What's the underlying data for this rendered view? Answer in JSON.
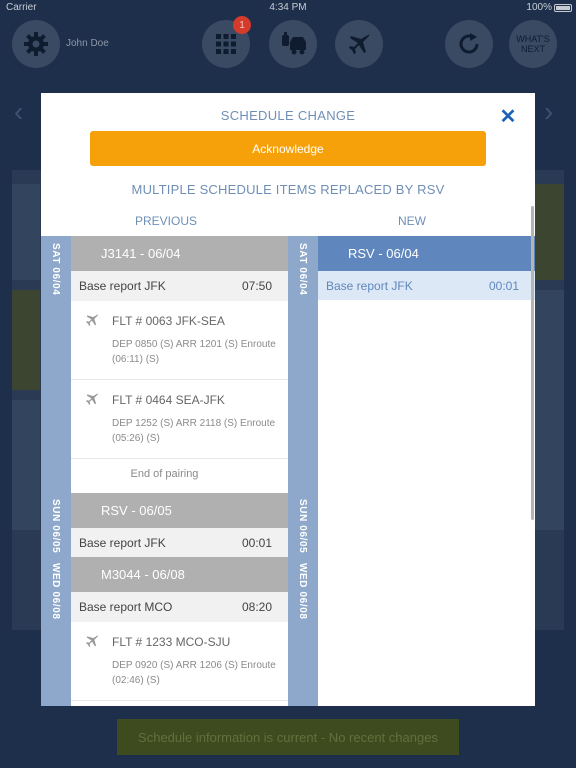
{
  "status_bar": {
    "carrier": "Carrier",
    "time": "4:34 PM",
    "battery": "100%"
  },
  "top_bar": {
    "user_name": "John Doe",
    "notification_count": "1",
    "whats_next_label": "WHAT'S NEXT"
  },
  "background": {
    "status_message": "Schedule information is current - No recent changes"
  },
  "modal": {
    "title": "SCHEDULE CHANGE",
    "acknowledge_label": "Acknowledge",
    "subtitle": "MULTIPLE SCHEDULE ITEMS REPLACED BY RSV",
    "previous_label": "PREVIOUS",
    "new_label": "NEW",
    "previous": {
      "day1": "SAT 06/04",
      "day2": "SUN 06/05",
      "day3": "WED 06/08",
      "pairing1": "J3141 - 06/04",
      "base1": {
        "label": "Base report  JFK",
        "time": "07:50"
      },
      "flt1": {
        "title": "FLT # 0063 JFK-SEA",
        "detail": "DEP 0850 (S)  ARR 1201 (S) Enroute (06:11) (S)"
      },
      "flt2": {
        "title": "FLT # 0464 SEA-JFK",
        "detail": "DEP 1252 (S)  ARR 2118 (S) Enroute (05:26) (S)"
      },
      "end_of_pairing": "End of pairing",
      "rsv": "RSV - 06/05",
      "base2": {
        "label": "Base report  JFK",
        "time": "00:01"
      },
      "pairing2": "M3044 - 06/08",
      "base3": {
        "label": "Base report  MCO",
        "time": "08:20"
      },
      "flt3": {
        "title": "FLT # 1233 MCO-SJU",
        "detail": "DEP 0920 (S)  ARR 1206 (S) Enroute (02:46) (S)"
      }
    },
    "new": {
      "day1": "SAT 06/04",
      "day2": "SUN 06/05",
      "day3": "WED 06/08",
      "rsv": "RSV - 06/04",
      "base": {
        "label": "Base report  JFK",
        "time": "00:01"
      }
    }
  },
  "icons": [
    "gear-icon",
    "grid-icon",
    "crew-transport-icon",
    "airplane-icon",
    "refresh-icon",
    "close-icon",
    "chevron-left-icon",
    "chevron-right-icon"
  ]
}
